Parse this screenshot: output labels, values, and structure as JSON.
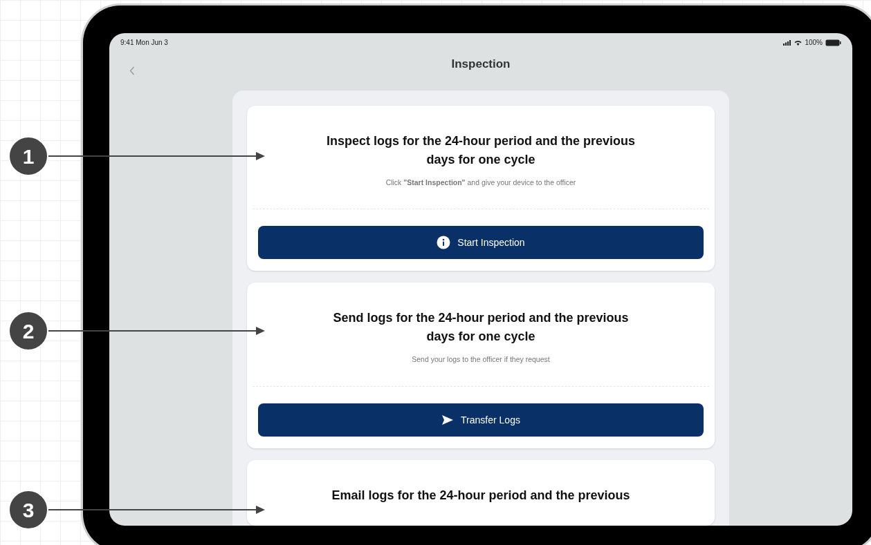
{
  "status_bar": {
    "time": "9:41 Mon Jun 3",
    "battery": "100%"
  },
  "header": {
    "title": "Inspection"
  },
  "cards": [
    {
      "title": "Inspect logs for the 24-hour period and the previous days for one cycle",
      "subtitle": "Click **\"Start Inspection\"** and give your device to the officer",
      "button": {
        "label": "Start Inspection",
        "kind": "info"
      }
    },
    {
      "title": "Send logs for the 24-hour period and the previous days for one cycle",
      "subtitle": "Send your logs to the officer if they request",
      "button": {
        "label": "Transfer Logs",
        "kind": "send"
      }
    },
    {
      "title": "Email logs for the 24-hour period and the previous"
    }
  ],
  "callouts": [
    "1",
    "2",
    "3"
  ]
}
